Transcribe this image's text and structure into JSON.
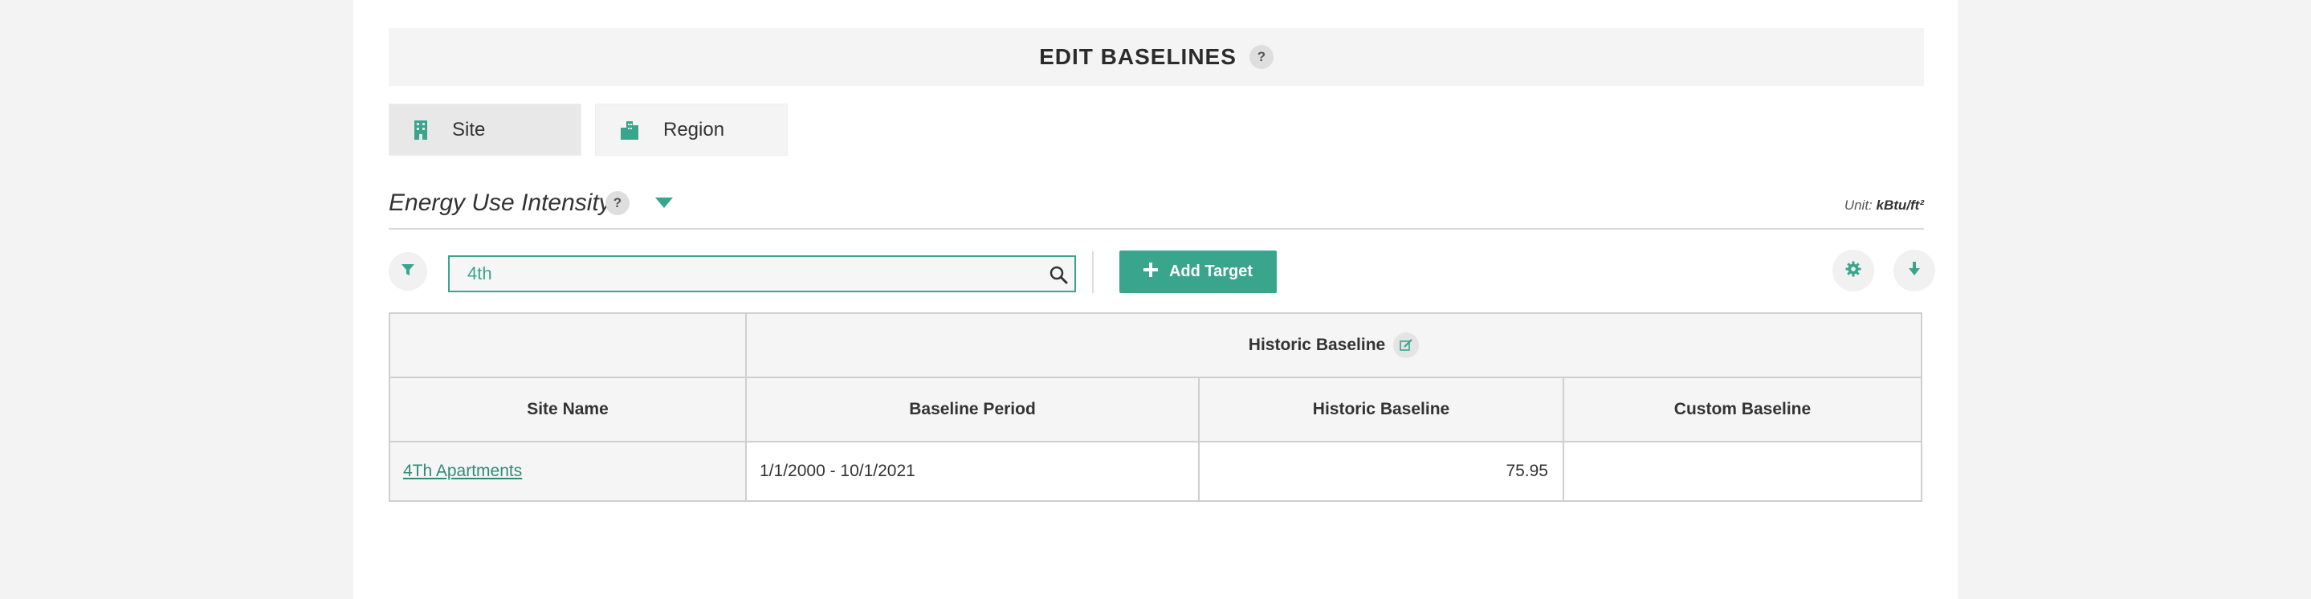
{
  "header": {
    "title": "EDIT BASELINES",
    "help": "?"
  },
  "tabs": [
    {
      "label": "Site",
      "icon": "building-icon",
      "active": true
    },
    {
      "label": "Region",
      "icon": "city-icon",
      "active": false
    }
  ],
  "metric": {
    "title": "Energy Use Intensity",
    "help": "?",
    "unit_label": "Unit:",
    "unit_value": "kBtu/ft²"
  },
  "toolbar": {
    "search_value": "4th",
    "add_target_label": "Add Target"
  },
  "table": {
    "group_header": "Historic Baseline",
    "columns": [
      "Site Name",
      "Baseline Period",
      "Historic Baseline",
      "Custom Baseline"
    ],
    "rows": [
      {
        "site_name": "4Th Apartments",
        "baseline_period": "1/1/2000 - 10/1/2021",
        "historic_baseline": "75.95",
        "custom_baseline": ""
      }
    ]
  },
  "colors": {
    "accent": "#3aa58d",
    "header_bg": "#f4f4f4",
    "page_bg": "#f3f3f3"
  }
}
